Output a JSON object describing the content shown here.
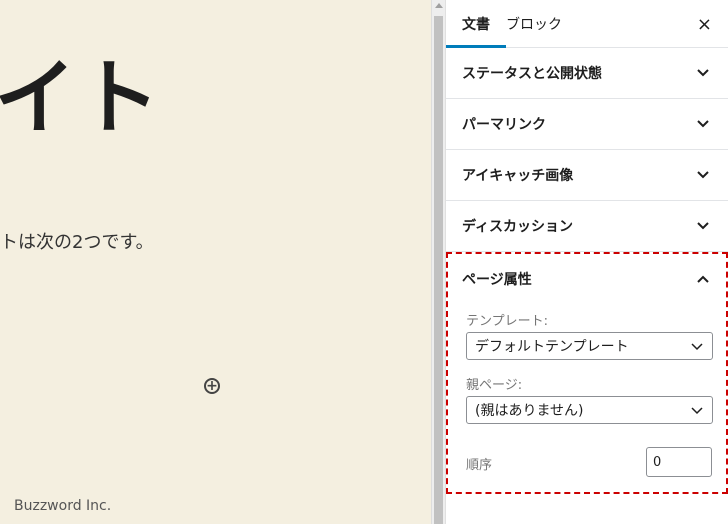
{
  "canvas": {
    "title_fragment": "イト",
    "body_fragment": "トは次の2つです。",
    "footer": "Buzzword Inc."
  },
  "sidebar": {
    "tabs": [
      {
        "label": "文書",
        "active": true
      },
      {
        "label": "ブロック",
        "active": false
      }
    ],
    "close_label": "×",
    "panels": [
      {
        "title": "ステータスと公開状態"
      },
      {
        "title": "パーマリンク"
      },
      {
        "title": "アイキャッチ画像"
      },
      {
        "title": "ディスカッション"
      }
    ],
    "page_attributes": {
      "title": "ページ属性",
      "template_label": "テンプレート:",
      "template_value": "デフォルトテンプレート",
      "parent_label": "親ページ:",
      "parent_value": "(親はありません)",
      "order_label": "順序",
      "order_value": "0"
    }
  },
  "colors": {
    "canvas_bg": "#f4efe0",
    "accent": "#007cba",
    "highlight_border": "#cc0000"
  }
}
